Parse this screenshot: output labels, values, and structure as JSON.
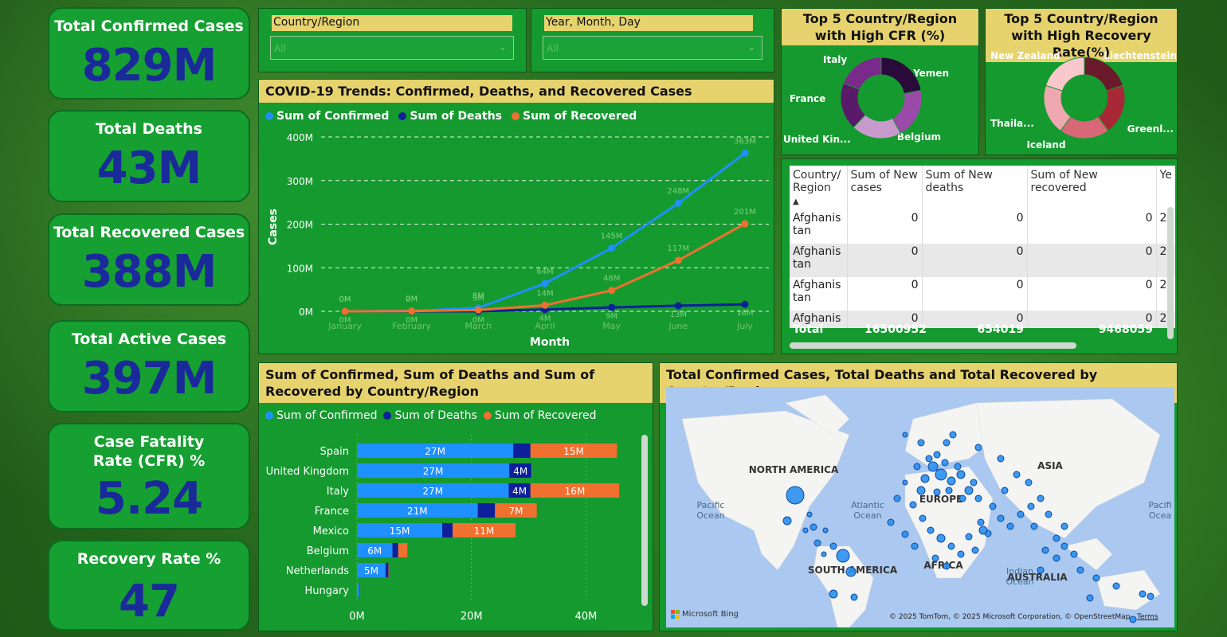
{
  "kpis": [
    {
      "label": "Total Confirmed Cases",
      "value": "829M"
    },
    {
      "label": "Total Deaths",
      "value": "43M"
    },
    {
      "label": "Total Recovered Cases",
      "value": "388M"
    },
    {
      "label": "Total Active Cases",
      "value": "397M"
    },
    {
      "label": "Case Fatality Rate (CFR) %",
      "value": "5.24"
    },
    {
      "label": "Recovery Rate %",
      "value": "47"
    }
  ],
  "slicers": [
    {
      "label": "Country/Region",
      "value": "All"
    },
    {
      "label": "Year, Month, Day",
      "value": "All"
    }
  ],
  "colors": {
    "confirmed": "#1e90ff",
    "deaths": "#0d1f9a",
    "recovered": "#f07030",
    "panel": "#16a032",
    "title_bar": "#e6d36e"
  },
  "chart_data": [
    {
      "type": "line",
      "title": "COVID-19 Trends: Confirmed, Deaths, and Recovered Cases",
      "xlabel": "Month",
      "ylabel": "Cases",
      "categories": [
        "January",
        "February",
        "March",
        "April",
        "May",
        "June",
        "July"
      ],
      "yticks": [
        "0M",
        "100M",
        "200M",
        "300M",
        "400M"
      ],
      "ylim": [
        0,
        400
      ],
      "grid": true,
      "legend": "top",
      "series": [
        {
          "name": "Sum of Confirmed",
          "values": [
            0.1,
            1,
            8,
            64,
            145,
            248,
            363
          ],
          "labels": [
            "0M",
            "2M",
            "8M",
            "64M",
            "145M",
            "248M",
            "363M"
          ]
        },
        {
          "name": "Sum of Deaths",
          "values": [
            0,
            0,
            0.1,
            4,
            9,
            13,
            16
          ],
          "labels": [
            "0M",
            "0M",
            "0M",
            "4M",
            "9M",
            "13M",
            "16M"
          ]
        },
        {
          "name": "Sum of Recovered",
          "values": [
            0,
            0.5,
            3,
            14,
            48,
            117,
            201
          ],
          "labels": [
            "0M",
            "0M",
            "3M",
            "14M",
            "48M",
            "117M",
            "201M"
          ]
        }
      ]
    },
    {
      "type": "bar",
      "orientation": "horizontal-stacked",
      "title": "Sum of Confirmed, Sum of Deaths and Sum of Recovered by Country/Region",
      "categories": [
        "Spain",
        "United Kingdom",
        "Italy",
        "France",
        "Mexico",
        "Belgium",
        "Netherlands",
        "Hungary"
      ],
      "xticks": [
        "0M",
        "20M",
        "40M"
      ],
      "xlim": [
        0,
        48
      ],
      "legend": "top",
      "series": [
        {
          "name": "Sum of Confirmed",
          "values": [
            27.3,
            26.6,
            26.5,
            21.1,
            14.9,
            6.2,
            5.0,
            0.4
          ],
          "labels": [
            "27M",
            "27M",
            "27M",
            "21M",
            "15M",
            "6M",
            "5M",
            ""
          ]
        },
        {
          "name": "Sum of Deaths",
          "values": [
            3.0,
            3.9,
            3.8,
            3.0,
            1.8,
            1.0,
            0.5,
            0.1
          ],
          "labels": [
            "",
            "4M",
            "4M",
            "",
            "",
            "",
            "",
            ""
          ]
        },
        {
          "name": "Sum of Recovered",
          "values": [
            15.1,
            0.1,
            15.5,
            7.3,
            11.0,
            1.6,
            0.05,
            0.05
          ],
          "labels": [
            "15M",
            "",
            "16M",
            "7M",
            "11M",
            "",
            "",
            ""
          ]
        }
      ]
    },
    {
      "type": "pie",
      "title": "Top 5 Country/Region with High CFR (%)",
      "categories": [
        "Yemen",
        "Belgium",
        "United Kin...",
        "France",
        "Italy"
      ],
      "values": [
        22,
        20,
        20,
        19,
        19
      ],
      "colors": [
        "#2a0a3a",
        "#9a4aa8",
        "#c89acc",
        "#5a1a6a",
        "#7a2a8a"
      ]
    },
    {
      "type": "pie",
      "title": "Top 5 Country/Region with High Recovery Rate(%)",
      "categories": [
        "Liechtenstein",
        "Greenl...",
        "Iceland",
        "Thaila...",
        "New Zealand"
      ],
      "values": [
        20,
        20,
        20,
        20,
        20
      ],
      "colors": [
        "#6a1a2a",
        "#a82838",
        "#d86878",
        "#f0a8b0",
        "#f8c8cc"
      ]
    }
  ],
  "table": {
    "headers": [
      "Country/ Region",
      "Sum of New cases",
      "Sum of New deaths",
      "Sum of New recovered",
      "Ye"
    ],
    "rows": [
      {
        "country": "Afghanis tan",
        "new_cases": "0",
        "new_deaths": "0",
        "new_recovered": "0",
        "year": "2"
      },
      {
        "country": "Afghanis tan",
        "new_cases": "0",
        "new_deaths": "0",
        "new_recovered": "0",
        "year": "2"
      },
      {
        "country": "Afghanis tan",
        "new_cases": "0",
        "new_deaths": "0",
        "new_recovered": "0",
        "year": "2"
      },
      {
        "country": "Afghanis",
        "new_cases": "0",
        "new_deaths": "0",
        "new_recovered": "0",
        "year": "2"
      }
    ],
    "total": {
      "label": "Total",
      "new_cases": "16500952",
      "new_deaths": "654019",
      "new_recovered": "9468059"
    }
  },
  "map": {
    "title": "Total Confirmed Cases, Total Deaths and Total Recovered by Country/Region",
    "labels": [
      "NORTH AMERICA",
      "EUROPE",
      "ASIA",
      "AFRICA",
      "SOUTH AMERICA",
      "AUSTRALIA",
      "Pacific Ocean",
      "Atlantic Ocean",
      "Indian Ocean",
      "Pacifi Ocea"
    ],
    "attribution": "© 2025 TomTom, © 2025 Microsoft Corporation, © OpenStreetMap",
    "terms": "Terms",
    "brand": "Microsoft Bing"
  }
}
